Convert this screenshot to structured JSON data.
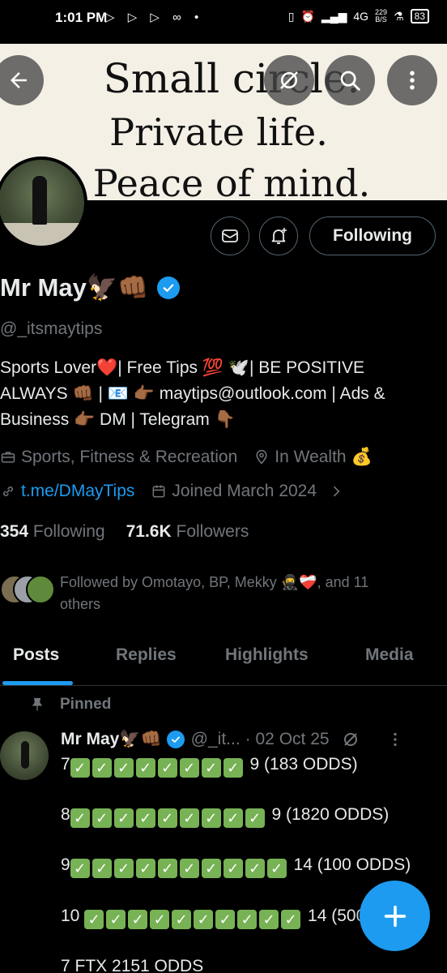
{
  "status_bar": {
    "time": "1:01 PM",
    "left_icons": "▷ ▷ ▷ ∞ •",
    "net_speed_top": "229",
    "net_speed_bottom": "B/S",
    "signal": "4G",
    "battery": "83"
  },
  "banner": {
    "line1": "Small circle.",
    "line2": "Private life.",
    "line3": "Peace of mind."
  },
  "actions": {
    "following_label": "Following"
  },
  "profile": {
    "name": "Mr May🦅👊🏾",
    "handle": "@_itsmaytips",
    "bio_line1": "Sports Lover❤️| Free Tips 💯 🕊️| BE POSITIVE",
    "bio_line2": "ALWAYS 👊🏾 | 📧 👉🏾 maytips@outlook.com | Ads &",
    "bio_line3": "Business 👉🏾 DM | Telegram 👇🏾",
    "category": "Sports, Fitness & Recreation",
    "location": "In Wealth 💰",
    "link": "t.me/DMayTips",
    "joined": "Joined March 2024",
    "following_count": "354",
    "following_label": "Following",
    "followers_count": "71.6K",
    "followers_label": "Followers",
    "followed_by_line1": "Followed by Omotayo, BP, Mekky 🥷❤️‍🩹, and 11",
    "followed_by_line2": "others"
  },
  "tabs": [
    {
      "label": "Posts"
    },
    {
      "label": "Replies"
    },
    {
      "label": "Highlights"
    },
    {
      "label": "Media"
    }
  ],
  "post": {
    "pinned_label": "Pinned",
    "author": "Mr May🦅👊🏾",
    "handle": "@_it...",
    "date": "· 02 Oct 25",
    "line1_prefix": "7",
    "line1_suffix": "9 (183 ODDS)",
    "line2_prefix": "8",
    "line2_suffix": "9 (1820 ODDS)",
    "line3_prefix": "9",
    "line3_suffix": "14 (100 ODDS)",
    "line4_prefix": "10",
    "line4_suffix": "14 (500",
    "line5": "7 FTX 2151 ODDS"
  },
  "colors": {
    "accent": "#1d9bf0",
    "background": "#000000",
    "text_primary": "#e7e9ea",
    "text_secondary": "#71767b",
    "check_green": "#77b255"
  }
}
